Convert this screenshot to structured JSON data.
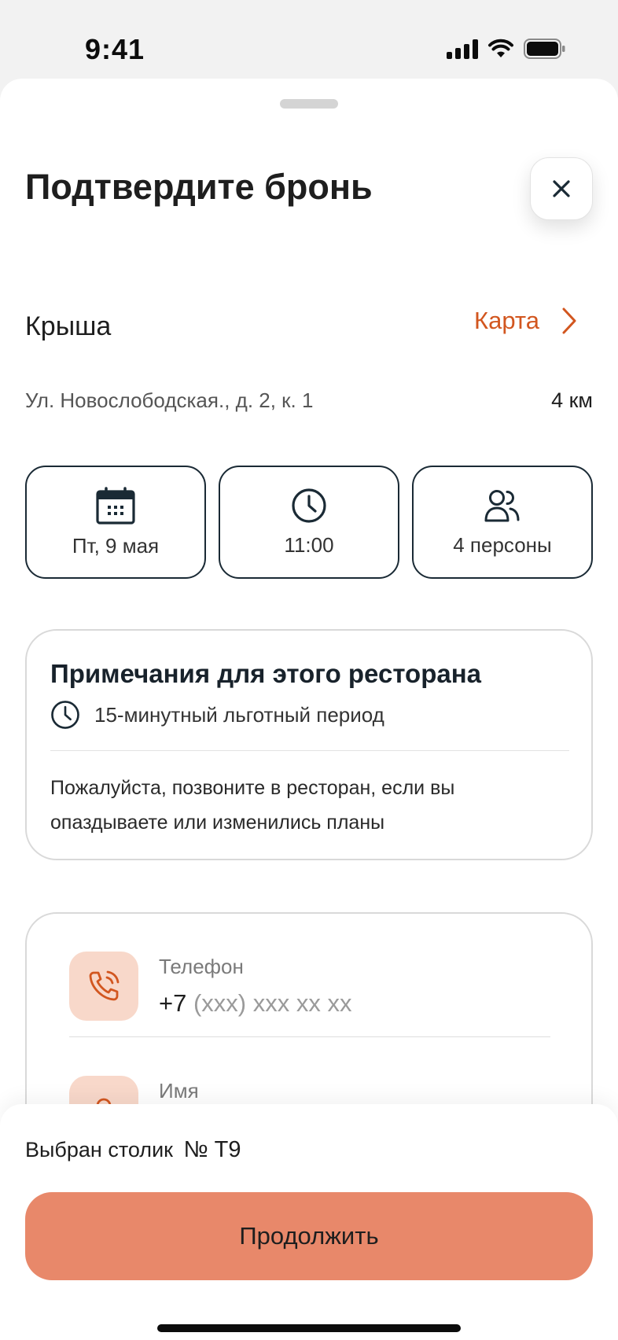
{
  "status_bar": {
    "time": "9:41"
  },
  "sheet": {
    "title": "Подтвердите бронь"
  },
  "venue": {
    "name": "Крыша",
    "map_label": "Карта",
    "address": "Ул. Новослободская., д. 2, к. 1",
    "distance": "4 км"
  },
  "chips": [
    {
      "icon": "calendar-icon",
      "label": "Пт, 9 мая"
    },
    {
      "icon": "clock-icon",
      "label": "11:00"
    },
    {
      "icon": "people-icon",
      "label": "4 персоны"
    }
  ],
  "notes": {
    "title": "Примечания для этого ресторана",
    "grace_period": "15-минутный льготный период",
    "body": "Пожалуйста, позвоните в ресторан, если вы опаздываете или изменились планы"
  },
  "contact": {
    "phone_label": "Телефон",
    "phone_prefix": "+7",
    "phone_placeholder": "(xxx) xxx xx xx",
    "name_label": "Имя"
  },
  "footer": {
    "table_label": "Выбран столик",
    "table_number": "№ Т9",
    "continue_label": "Продолжить"
  },
  "colors": {
    "accent": "#d2561f",
    "button": "#e8886a",
    "icon_bg": "#f8d8ca",
    "chip_border": "#1a2a35"
  }
}
